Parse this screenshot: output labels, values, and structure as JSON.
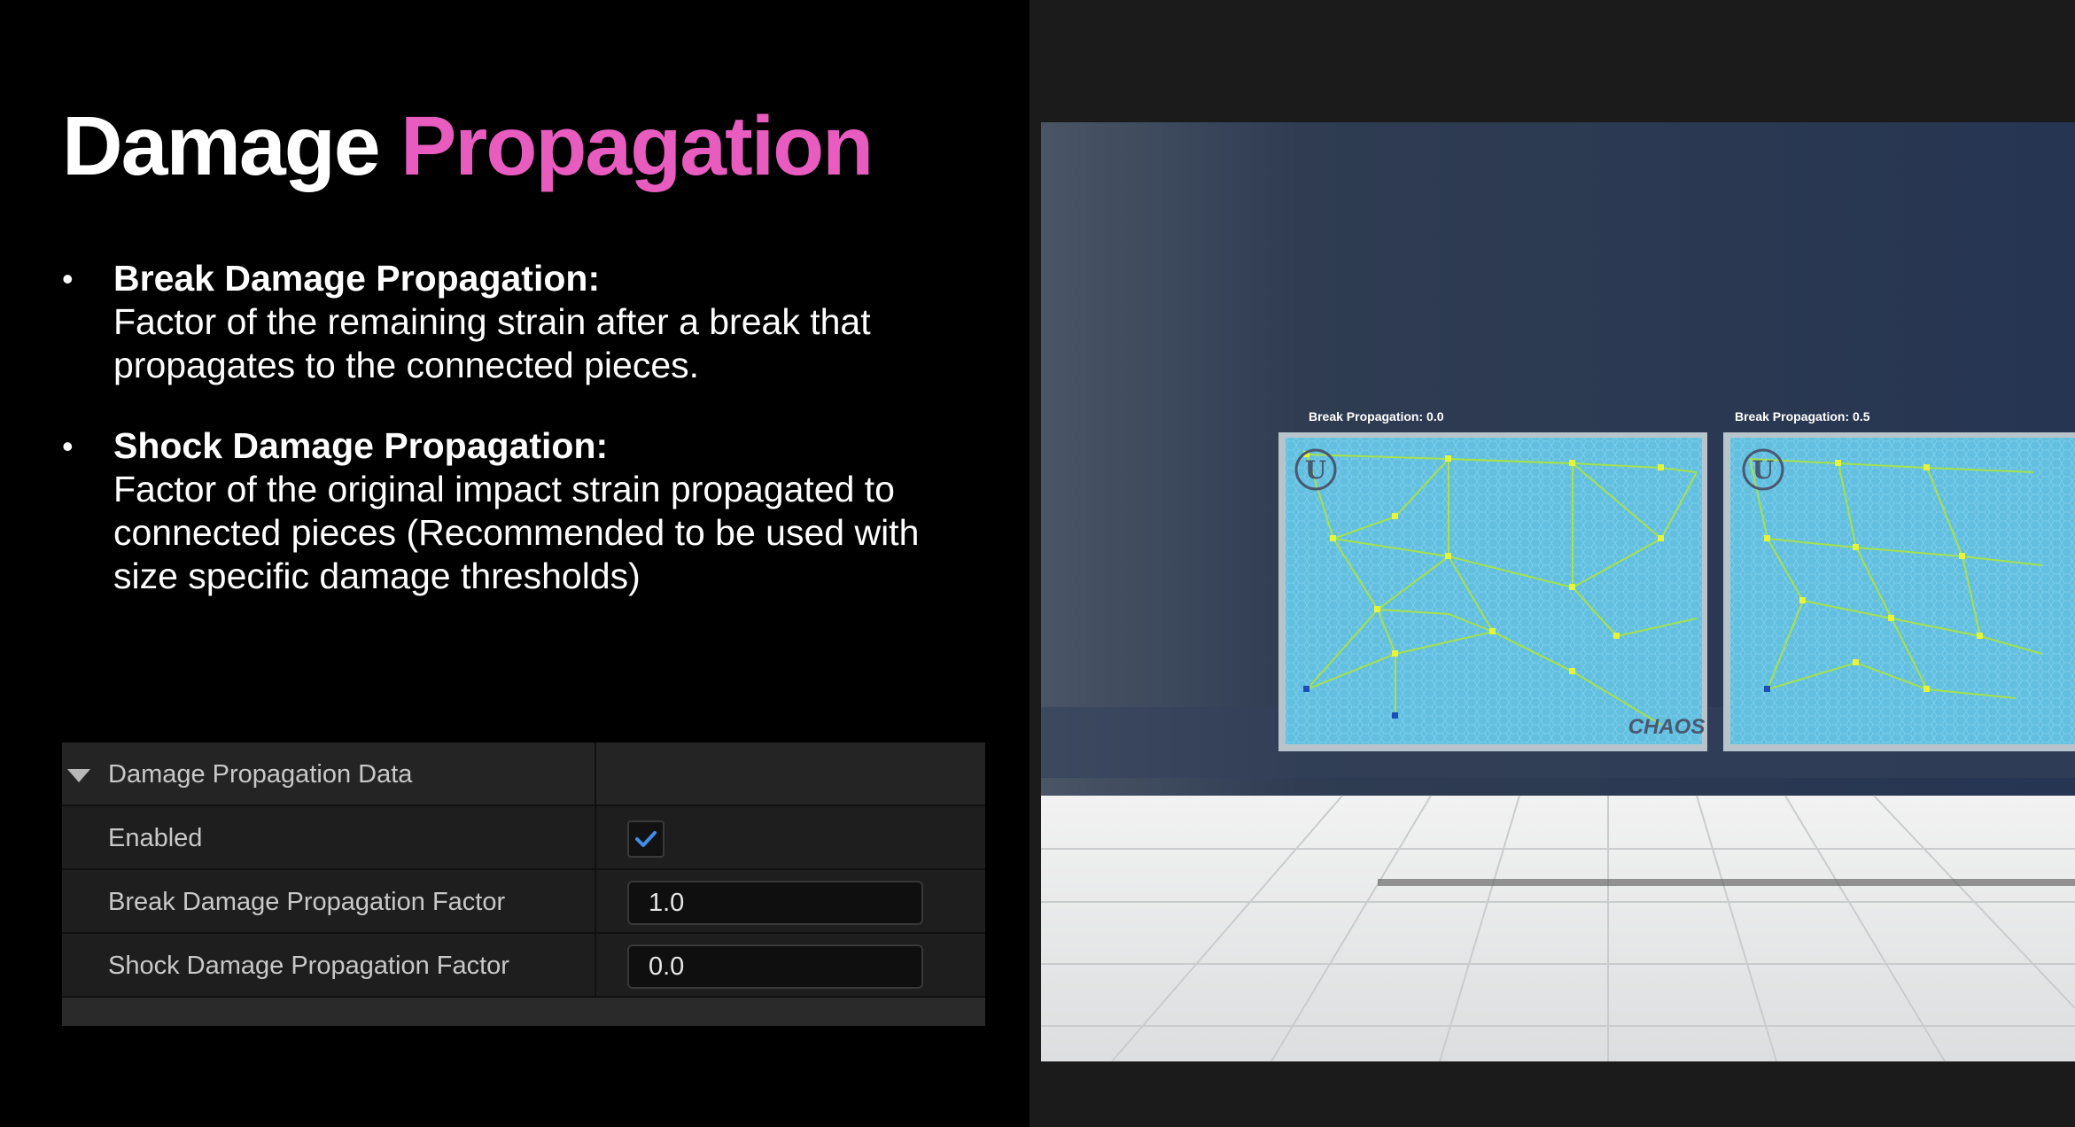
{
  "slide": {
    "title_part1": "Damage",
    "title_part2": "Propagation",
    "bullets": [
      {
        "heading": "Break Damage Propagation:",
        "body": "Factor of the remaining strain after a break that propagates to the connected pieces."
      },
      {
        "heading": "Shock Damage Propagation:",
        "body": "Factor of the original impact strain propagated to connected pieces (Recommended to be used with size specific damage thresholds)"
      }
    ]
  },
  "details_panel": {
    "section_title": "Damage Propagation Data",
    "rows": [
      {
        "label": "Enabled",
        "checked": true
      },
      {
        "label": "Break Damage Propagation Factor",
        "value": "1.0"
      },
      {
        "label": "Shock Damage Propagation Factor",
        "value": "0.0"
      }
    ]
  },
  "viewport": {
    "captions": [
      "Break Propagation: 0.0",
      "Break Propagation: 0.5"
    ],
    "watermark": "CHAOS",
    "colors": {
      "glass": "#62bfe0",
      "mesh_lines": "#a6e24a",
      "nodes": "#e6f53a",
      "wall": "#2b3a55",
      "floor": "#e8eaea"
    }
  },
  "icons": {
    "collapse": "chevron-down-icon",
    "check": "checkmark-icon",
    "unreal_logo": "unreal-logo-icon"
  }
}
